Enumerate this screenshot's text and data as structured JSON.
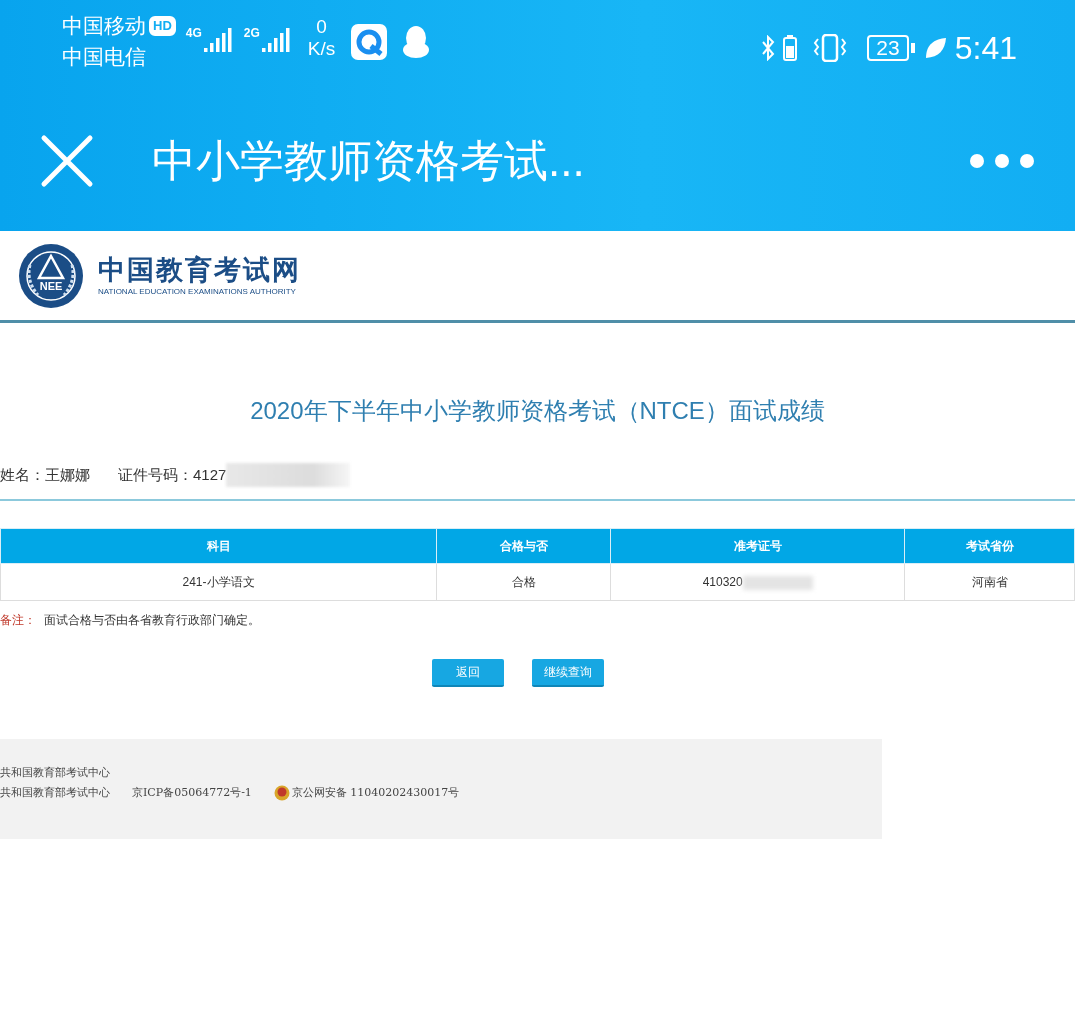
{
  "status_bar": {
    "carriers": [
      "中国移动",
      "中国电信"
    ],
    "hd_badge": "HD",
    "networks": [
      {
        "label": "4G"
      },
      {
        "label": "2G"
      }
    ],
    "speed_value": "0",
    "speed_unit": "K/s",
    "battery": "23",
    "time": "5:41"
  },
  "title_bar": {
    "title": "中小学教师资格考试..."
  },
  "site_header": {
    "logo_text": "NEE",
    "site_name": "中国教育考试网",
    "site_name_en": "NATIONAL EDUCATION EXAMINATIONS AUTHORITY"
  },
  "page_title": "2020年下半年中小学教师资格考试（NTCE）面试成绩",
  "candidate": {
    "name_label": "姓名：",
    "name": "王娜娜",
    "id_label": "证件号码：",
    "id_visible": "4127"
  },
  "table": {
    "columns": [
      "科目",
      "合格与否",
      "准考证号",
      "考试省份"
    ],
    "rows": [
      [
        "241-小学语文",
        "合格",
        "410320",
        "河南省"
      ]
    ]
  },
  "note": {
    "label": "备注：",
    "text": "面试合格与否由各省教育行政部门确定。"
  },
  "buttons": [
    "返回",
    "继续查询"
  ],
  "footer": {
    "lines": [
      "共和国教育部考试中心"
    ],
    "org": "共和国教育部考试中心",
    "icp": "京ICP备05064772号-1",
    "police": "京公网安备 11040202430017号"
  }
}
